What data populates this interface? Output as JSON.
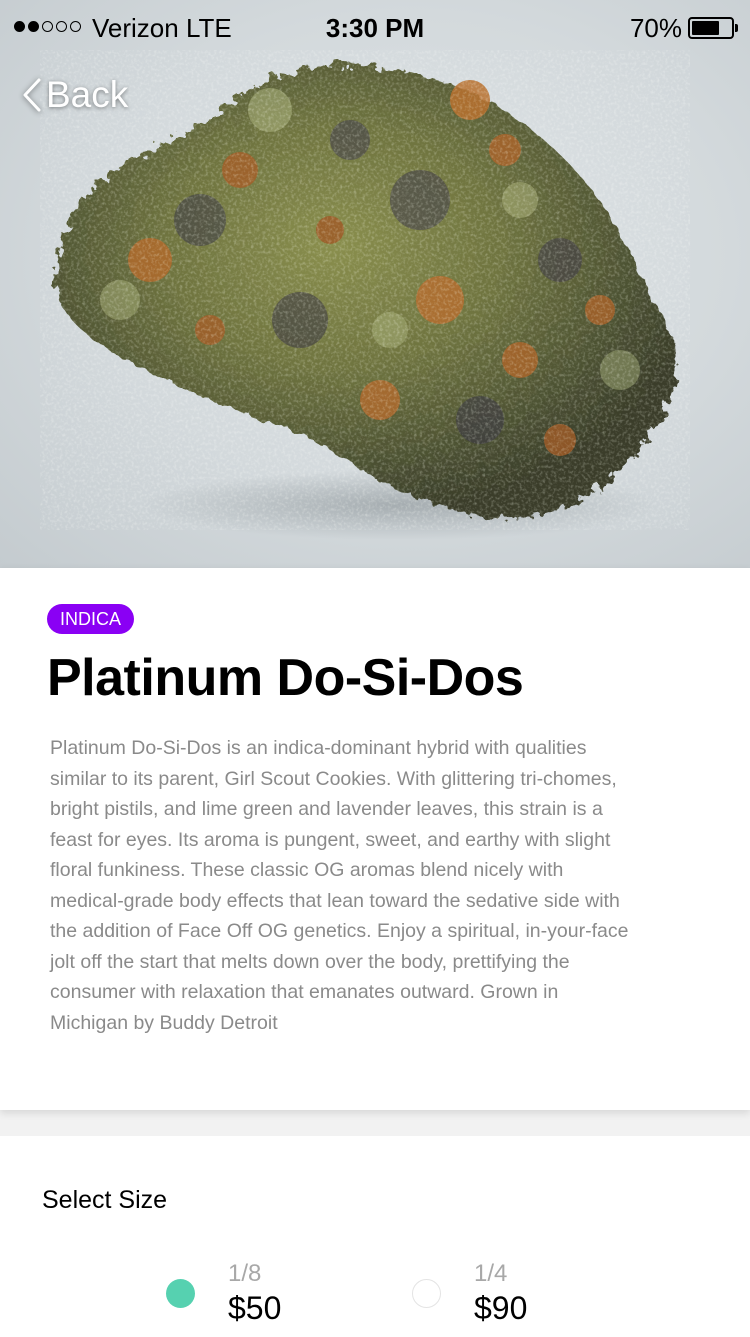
{
  "status_bar": {
    "carrier": "Verizon LTE",
    "time": "3:30 PM",
    "battery": "70%",
    "battery_level": 0.7,
    "signal_bars_filled": 2,
    "signal_bars_total": 5
  },
  "nav": {
    "back_label": "Back"
  },
  "product": {
    "category_badge": "INDICA",
    "name": "Platinum Do-Si-Dos",
    "description": "Platinum Do-Si-Dos is an indica-dominant hybrid with qualities similar to its parent, Girl Scout Cookies. With glittering tri-chomes, bright pistils, and lime green and lavender leaves, this strain is a feast for eyes. Its aroma is pungent, sweet, and earthy with slight floral funkiness. These classic OG aromas blend nicely with medical-grade body effects that lean toward the sedative side with the addition of Face Off OG genetics. Enjoy a spiritual, in-your-face jolt off the start that melts down over the body, prettifying the consumer with relaxation that emanates outward. Grown in Michigan by Buddy Detroit"
  },
  "size_selector": {
    "heading": "Select Size",
    "options": [
      {
        "fraction": "1/8",
        "price": "$50",
        "selected": true
      },
      {
        "fraction": "1/4",
        "price": "$90",
        "selected": false
      }
    ]
  },
  "colors": {
    "badge": "#8a00f4",
    "selected_radio": "#56d1b0",
    "description_text": "#8a8a8a"
  }
}
